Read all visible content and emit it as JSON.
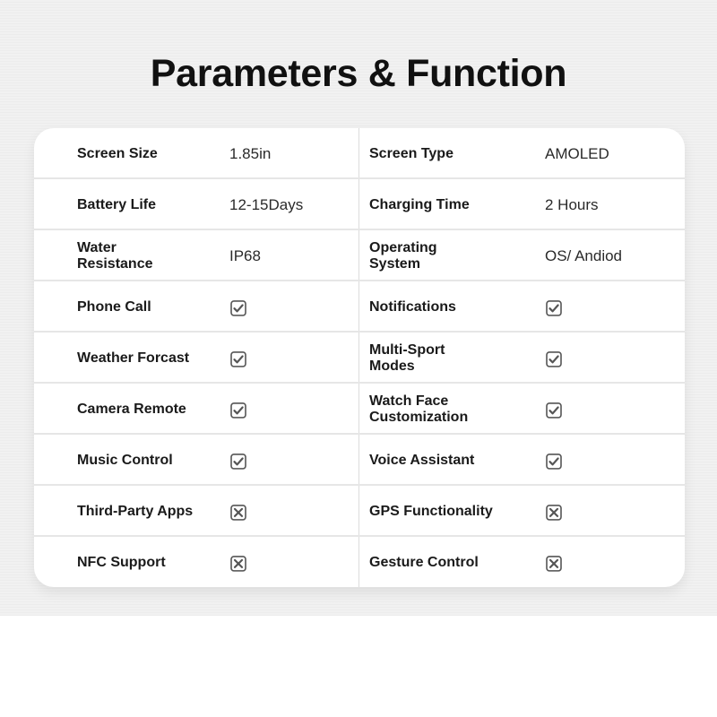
{
  "title": "Parameters & Function",
  "rows": [
    {
      "left": {
        "label": "Screen Size",
        "value": "1.85in"
      },
      "right": {
        "label": "Screen Type",
        "value": "AMOLED"
      }
    },
    {
      "left": {
        "label": "Battery Life",
        "value": "12-15Days"
      },
      "right": {
        "label": "Charging Time",
        "value": "2 Hours"
      }
    },
    {
      "left": {
        "label": "Water\nResistance",
        "value": "IP68"
      },
      "right": {
        "label": "Operating\nSystem",
        "value": "OS/ Andiod"
      }
    },
    {
      "left": {
        "label": "Phone Call",
        "icon": "check-icon"
      },
      "right": {
        "label": "Notifications",
        "icon": "check-icon"
      }
    },
    {
      "left": {
        "label": "Weather Forcast",
        "icon": "check-icon"
      },
      "right": {
        "label": "Multi-Sport\nModes",
        "icon": "check-icon"
      }
    },
    {
      "left": {
        "label": "Camera Remote",
        "icon": "check-icon"
      },
      "right": {
        "label": "Watch Face\nCustomization",
        "icon": "check-icon"
      }
    },
    {
      "left": {
        "label": "Music Control",
        "icon": "check-icon"
      },
      "right": {
        "label": "Voice Assistant",
        "icon": "check-icon"
      }
    },
    {
      "left": {
        "label": "Third-Party Apps",
        "icon": "cross-icon"
      },
      "right": {
        "label": "GPS Functionality",
        "icon": "cross-icon"
      }
    },
    {
      "left": {
        "label": "NFC Support",
        "icon": "cross-icon"
      },
      "right": {
        "label": "Gesture Control",
        "icon": "cross-icon"
      }
    }
  ],
  "colors": {
    "icon": "#555555",
    "text": "#1a1a1a",
    "background": "#f1f1f1"
  }
}
